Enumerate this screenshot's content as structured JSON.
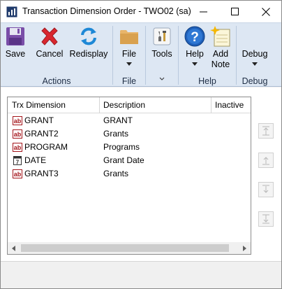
{
  "window": {
    "title": "Transaction Dimension Order  -  TWO02 (sa)"
  },
  "ribbon": {
    "groups": {
      "actions": {
        "label": "Actions",
        "save": "Save",
        "cancel": "Cancel",
        "redisplay": "Redisplay"
      },
      "file": {
        "label": "File",
        "file": "File"
      },
      "tools": {
        "label": "",
        "tools": "Tools"
      },
      "help": {
        "label": "Help",
        "help": "Help",
        "add_note_line1": "Add",
        "add_note_line2": "Note"
      },
      "debug": {
        "label": "Debug",
        "debug": "Debug"
      }
    }
  },
  "grid": {
    "columns": [
      "Trx Dimension",
      "Description",
      "Inactive"
    ],
    "rows": [
      {
        "dimension": "GRANT",
        "description": "GRANT",
        "icon": "alphanumeric-icon"
      },
      {
        "dimension": "GRANT2",
        "description": "Grants",
        "icon": "alphanumeric-icon"
      },
      {
        "dimension": "PROGRAM",
        "description": "Programs",
        "icon": "alphanumeric-icon"
      },
      {
        "dimension": "DATE",
        "description": "Grant Date",
        "icon": "date-icon"
      },
      {
        "dimension": "GRANT3",
        "description": "Grants",
        "icon": "alphanumeric-icon"
      }
    ]
  },
  "colors": {
    "ribbon_bg": "#dde7f3",
    "group_label": "#1e2d44",
    "icon_red": "#c0272d"
  }
}
